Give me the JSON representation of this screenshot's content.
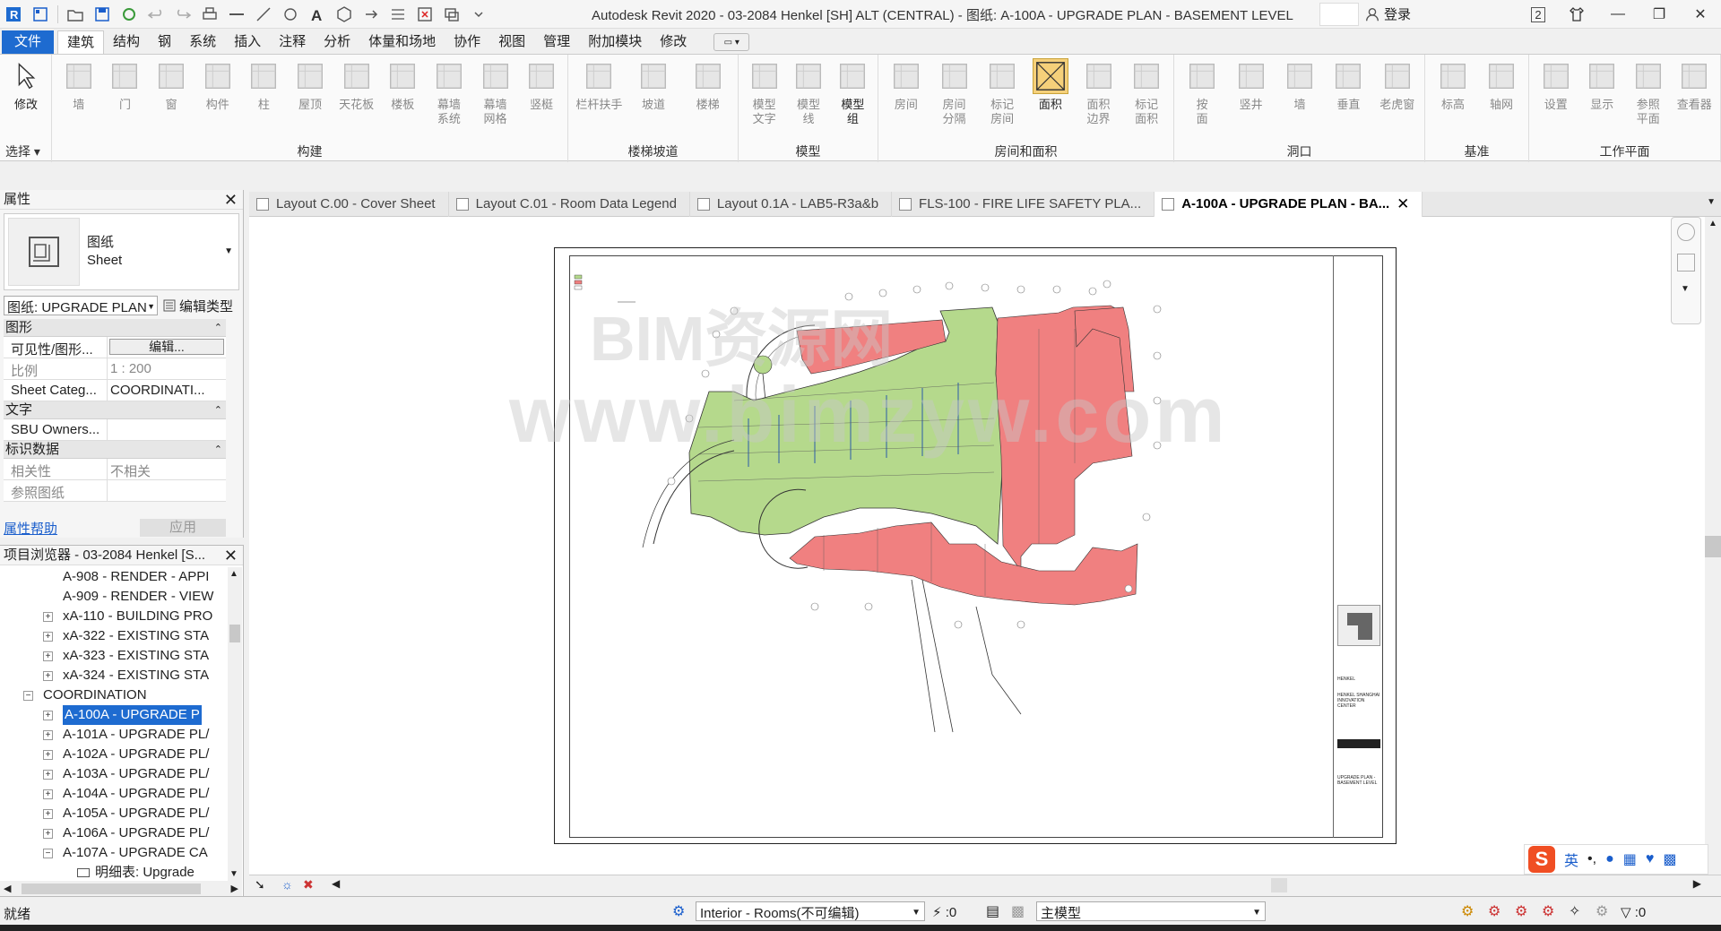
{
  "app": {
    "title": "Autodesk Revit 2020 - 03-2084 Henkel [SH] ALT (CENTRAL) - 图纸: A-100A - UPGRADE PLAN - BASEMENT LEVEL",
    "login": "登录",
    "notifications": "2"
  },
  "ribbon_tabs": [
    "文件",
    "建筑",
    "结构",
    "钢",
    "系统",
    "插入",
    "注释",
    "分析",
    "体量和场地",
    "协作",
    "视图",
    "管理",
    "附加模块",
    "修改"
  ],
  "ribbon": {
    "select": {
      "modify": "修改",
      "panel": "选择"
    },
    "build": {
      "panel": "构建",
      "buttons": [
        "墙",
        "门",
        "窗",
        "构件",
        "柱",
        "屋顶",
        "天花板",
        "楼板",
        "幕墙\n系统",
        "幕墙\n网格",
        "竖梃"
      ]
    },
    "circulation": {
      "panel": "楼梯坡道",
      "buttons": [
        "栏杆扶手",
        "坡道",
        "楼梯"
      ]
    },
    "model": {
      "panel": "模型",
      "buttons": [
        "模型\n文字",
        "模型\n线",
        "模型\n组"
      ]
    },
    "room": {
      "panel": "房间和面积",
      "buttons": [
        "房间",
        "房间\n分隔",
        "标记\n房间",
        "面积",
        "面积\n边界",
        "标记\n面积"
      ]
    },
    "opening": {
      "panel": "洞口",
      "buttons": [
        "按\n面",
        "竖井",
        "墙",
        "垂直",
        "老虎窗"
      ]
    },
    "datum": {
      "panel": "基准",
      "buttons": [
        "标高",
        "轴网"
      ]
    },
    "workplane": {
      "panel": "工作平面",
      "buttons": [
        "设置",
        "显示",
        "参照\n平面",
        "查看器"
      ]
    }
  },
  "properties": {
    "title": "属性",
    "type_name_cn": "图纸",
    "type_name_en": "Sheet",
    "instance_selector": "图纸: UPGRADE PLAN",
    "edit_type": "编辑类型",
    "categories": [
      {
        "name": "图形",
        "rows": [
          {
            "key": "可见性/图形...",
            "value": "编辑...",
            "button": true
          },
          {
            "key": "比例",
            "value": "1 : 200",
            "dim": true
          },
          {
            "key": "Sheet Categ...",
            "value": "COORDINATI..."
          }
        ]
      },
      {
        "name": "文字",
        "rows": [
          {
            "key": "SBU Owners...",
            "value": ""
          }
        ]
      },
      {
        "name": "标识数据",
        "rows": [
          {
            "key": "相关性",
            "value": "不相关",
            "dim": true
          },
          {
            "key": "参照图纸",
            "value": "",
            "dim": true
          }
        ]
      }
    ],
    "help": "属性帮助",
    "apply": "应用"
  },
  "browser": {
    "title": "项目浏览器 - 03-2084 Henkel [S...",
    "nodes": [
      {
        "label": "A-908 - RENDER - APPI",
        "indent": 2,
        "box": ""
      },
      {
        "label": "A-909 - RENDER - VIEW",
        "indent": 2,
        "box": ""
      },
      {
        "label": "xA-110 - BUILDING PRO",
        "indent": 2,
        "box": "+"
      },
      {
        "label": "xA-322 - EXISTING STA",
        "indent": 2,
        "box": "+"
      },
      {
        "label": "xA-323 - EXISTING STA",
        "indent": 2,
        "box": "+"
      },
      {
        "label": "xA-324 - EXISTING STA",
        "indent": 2,
        "box": "+"
      },
      {
        "label": "COORDINATION",
        "indent": 1,
        "box": "-"
      },
      {
        "label": "A-100A - UPGRADE P",
        "indent": 2,
        "box": "+",
        "selected": true
      },
      {
        "label": "A-101A - UPGRADE PL/",
        "indent": 2,
        "box": "+"
      },
      {
        "label": "A-102A - UPGRADE PL/",
        "indent": 2,
        "box": "+"
      },
      {
        "label": "A-103A - UPGRADE PL/",
        "indent": 2,
        "box": "+"
      },
      {
        "label": "A-104A - UPGRADE PL/",
        "indent": 2,
        "box": "+"
      },
      {
        "label": "A-105A - UPGRADE PL/",
        "indent": 2,
        "box": "+"
      },
      {
        "label": "A-106A - UPGRADE PL/",
        "indent": 2,
        "box": "+"
      },
      {
        "label": "A-107A - UPGRADE CA",
        "indent": 2,
        "box": "-"
      },
      {
        "label": "明细表: Upgrade",
        "indent": 3,
        "box": ""
      }
    ]
  },
  "doc_tabs": [
    {
      "label": "Layout C.00 - Cover Sheet"
    },
    {
      "label": "Layout C.01 - Room Data Legend"
    },
    {
      "label": "Layout 0.1A - LAB5-R3a&b"
    },
    {
      "label": "FLS-100 - FIRE LIFE SAFETY PLA..."
    },
    {
      "label": "A-100A - UPGRADE PLAN - BA...",
      "active": true
    }
  ],
  "sheet": {
    "watermark": "www.bimzyw.com",
    "watermark2": "BIM资源网",
    "title_block_client": "HENKEL",
    "title_block_project": "HENKEL SHANGHAI INNOVATION CENTER",
    "title_block_sheet": "UPGRADE PLAN - BASEMENT LEVEL"
  },
  "status": {
    "text": "就绪",
    "workset": "Interior - Rooms(不可编辑)",
    "editable": ":0",
    "design_option": "主模型",
    "filter": ":0"
  },
  "ime": {
    "logo": "S",
    "lang": "英"
  },
  "colors": {
    "accent": "#1e6bd0",
    "room_red": "#f08080",
    "room_green": "#b5d98c"
  }
}
